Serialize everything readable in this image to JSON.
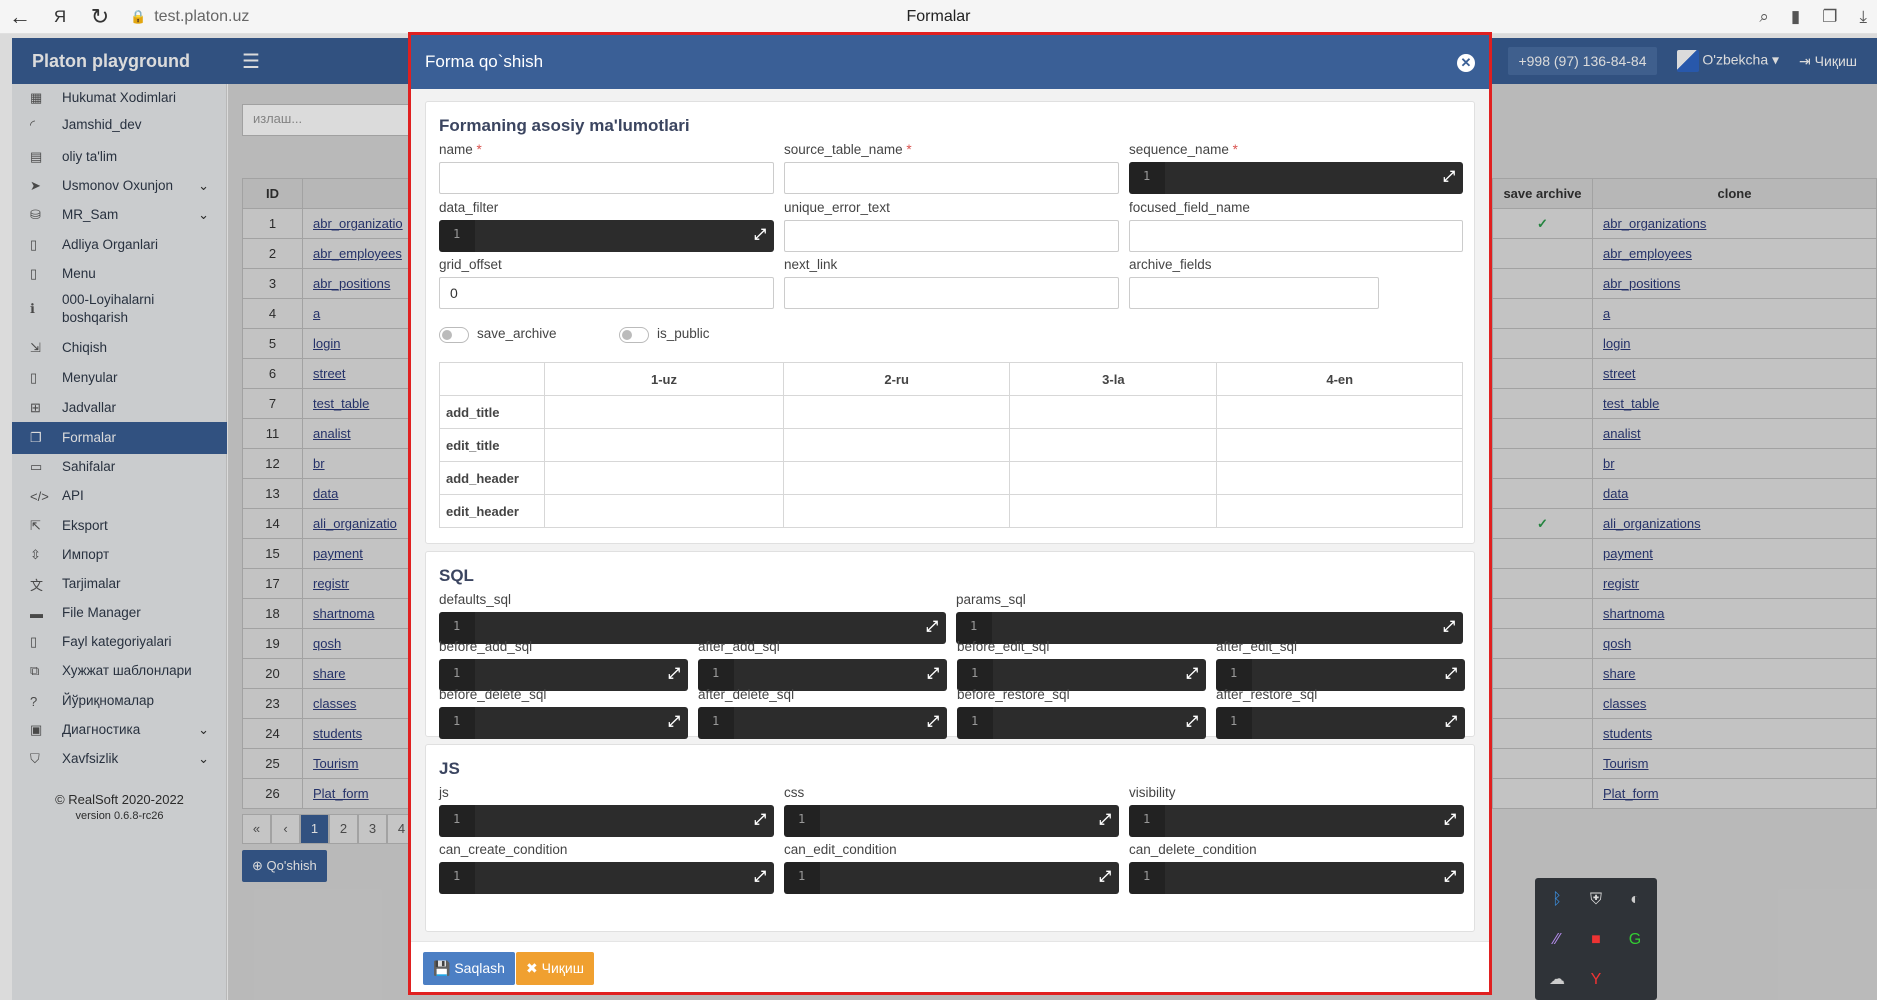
{
  "browser": {
    "url": "test.platon.uz",
    "tab_title": "Formalar"
  },
  "app": {
    "brand": "Platon playground",
    "phone": "+998 (97) 136-84-84",
    "language": "O'zbekcha",
    "logout": "Чиқиш"
  },
  "sidebar": {
    "items": [
      {
        "label": "Hukumat Xodimlari",
        "icon": "building-icon"
      },
      {
        "label": "Jamshid_dev",
        "icon": "spinner-icon"
      },
      {
        "label": "oliy ta'lim",
        "icon": "document-icon"
      },
      {
        "label": "Usmonov Oxunjon",
        "icon": "send-icon"
      },
      {
        "label": "MR_Sam",
        "icon": "database-icon"
      },
      {
        "label": "Adliya Organlari",
        "icon": "file-icon"
      },
      {
        "label": "Menu",
        "icon": "file-icon"
      },
      {
        "label": "000-Loyihalarni",
        "label2": "boshqarish",
        "icon": "info-icon"
      },
      {
        "label": "Chiqish",
        "icon": "sign-out-icon"
      },
      {
        "label": "Menyular",
        "icon": "file-icon"
      },
      {
        "label": "Jadvallar",
        "icon": "table-icon"
      },
      {
        "label": "Formalar",
        "icon": "clone-icon"
      },
      {
        "label": "Sahifalar",
        "icon": "window-icon"
      },
      {
        "label": "API",
        "icon": "code-icon"
      },
      {
        "label": "Eksport",
        "icon": "export-icon"
      },
      {
        "label": "Импорт",
        "icon": "import-icon"
      },
      {
        "label": "Tarjimalar",
        "icon": "translate-icon"
      },
      {
        "label": "File Manager",
        "icon": "folder-icon"
      },
      {
        "label": "Fayl kategoriyalari",
        "icon": "file-icon"
      },
      {
        "label": "Хужжат шаблонлари",
        "icon": "copy-icon"
      },
      {
        "label": "Йўриқномалар",
        "icon": "question-icon"
      },
      {
        "label": "Диагностика",
        "icon": "monitor-icon"
      },
      {
        "label": "Xavfsizlik",
        "icon": "shield-icon"
      }
    ],
    "footer_copyright": "© RealSoft 2020-2022",
    "footer_version": "version 0.6.8-rc26"
  },
  "background": {
    "search_placeholder": "излаш...",
    "table_headers": {
      "id": "ID",
      "save_archive": "save archive",
      "clone": "clone"
    },
    "rows": [
      {
        "id": "1",
        "name": "abr_organizatio",
        "archive": true,
        "clone": "abr_organizations"
      },
      {
        "id": "2",
        "name": "abr_employees",
        "archive": false,
        "clone": "abr_employees"
      },
      {
        "id": "3",
        "name": "abr_positions",
        "archive": false,
        "clone": "abr_positions"
      },
      {
        "id": "4",
        "name": "a",
        "archive": false,
        "clone": "a"
      },
      {
        "id": "5",
        "name": "login",
        "archive": false,
        "clone": "login"
      },
      {
        "id": "6",
        "name": "street",
        "archive": false,
        "clone": "street"
      },
      {
        "id": "7",
        "name": "test_table",
        "archive": false,
        "clone": "test_table"
      },
      {
        "id": "11",
        "name": "analist",
        "archive": false,
        "clone": "analist"
      },
      {
        "id": "12",
        "name": "br",
        "archive": false,
        "clone": "br"
      },
      {
        "id": "13",
        "name": "data",
        "archive": false,
        "clone": "data"
      },
      {
        "id": "14",
        "name": "ali_organizatio",
        "archive": true,
        "clone": "ali_organizations"
      },
      {
        "id": "15",
        "name": "payment",
        "archive": false,
        "clone": "payment"
      },
      {
        "id": "17",
        "name": "registr",
        "archive": false,
        "clone": "registr"
      },
      {
        "id": "18",
        "name": "shartnoma",
        "archive": false,
        "clone": "shartnoma"
      },
      {
        "id": "19",
        "name": "qosh",
        "archive": false,
        "clone": "qosh"
      },
      {
        "id": "20",
        "name": "share",
        "archive": false,
        "clone": "share"
      },
      {
        "id": "23",
        "name": "classes",
        "archive": false,
        "clone": "classes"
      },
      {
        "id": "24",
        "name": "students",
        "archive": false,
        "clone": "students"
      },
      {
        "id": "25",
        "name": "Tourism",
        "archive": false,
        "clone": "Tourism"
      },
      {
        "id": "26",
        "name": "Plat_form",
        "archive": false,
        "clone": "Plat_form"
      }
    ],
    "pager": [
      "«",
      "‹",
      "1",
      "2",
      "3",
      "4"
    ],
    "add_button": "Qo'shish"
  },
  "modal": {
    "title": "Forma qo`shish",
    "main_section_title": "Formaning asosiy ma'lumotlari",
    "labels": {
      "name": "name",
      "source_table_name": "source_table_name",
      "sequence_name": "sequence_name",
      "data_filter": "data_filter",
      "unique_error_text": "unique_error_text",
      "focused_field_name": "focused_field_name",
      "grid_offset": "grid_offset",
      "next_link": "next_link",
      "archive_fields": "archive_fields",
      "save_archive": "save_archive",
      "is_public": "is_public"
    },
    "grid_offset_value": "0",
    "line_number": "1",
    "lang_columns": [
      "1-uz",
      "2-ru",
      "3-la",
      "4-en"
    ],
    "lang_rows": [
      "add_title",
      "edit_title",
      "add_header",
      "edit_header"
    ],
    "sql_section_title": "SQL",
    "sql_fields": [
      "defaults_sql",
      "params_sql",
      "before_add_sql",
      "after_add_sql",
      "before_edit_sql",
      "after_edit_sql",
      "before_delete_sql",
      "after_delete_sql",
      "before_restore_sql",
      "after_restore_sql"
    ],
    "js_section_title": "JS",
    "js_fields": [
      "js",
      "css",
      "visibility",
      "can_create_condition",
      "can_edit_condition",
      "can_delete_condition"
    ],
    "save_button": "Saqlash",
    "exit_button": "Чиқиш"
  }
}
